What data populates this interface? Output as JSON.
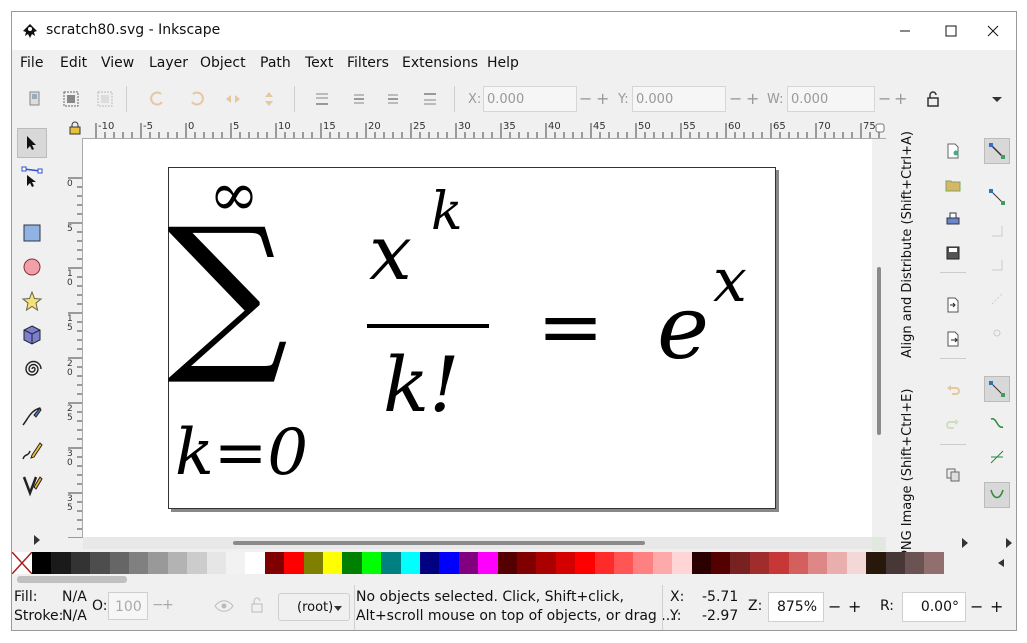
{
  "window": {
    "title": "scratch80.svg - Inkscape"
  },
  "menu": [
    "File",
    "Edit",
    "View",
    "Layer",
    "Object",
    "Path",
    "Text",
    "Filters",
    "Extensions",
    "Help"
  ],
  "toolbar": {
    "x_label": "X:",
    "x_value": "0.000",
    "y_label": "Y:",
    "y_value": "0.000",
    "w_label": "W:",
    "w_value": "0.000",
    "minus": "−",
    "plus": "+"
  },
  "ruler": {
    "top_ticks": [
      "-10",
      "-5",
      "0",
      "5",
      "10",
      "15",
      "20",
      "25",
      "30",
      "35",
      "40",
      "45",
      "50",
      "55",
      "60",
      "65",
      "70",
      "75"
    ],
    "left_ticks": [
      "0",
      "5",
      "10",
      "15",
      "20",
      "25",
      "30",
      "35",
      "40"
    ]
  },
  "canvas": {
    "formula": {
      "sum_upper": "∞",
      "sigma": "∑",
      "sum_lower": "k=0",
      "numerator_base": "x",
      "numerator_exp": "k",
      "denominator": "k!",
      "equals": "=",
      "rhs_base": "e",
      "rhs_exp": "x"
    }
  },
  "dock": {
    "tab_align": "Align and Distribute (Shift+Ctrl+A)",
    "tab_png": "PNG Image (Shift+Ctrl+E)"
  },
  "palette": {
    "colors": [
      "#000000",
      "#1a1a1a",
      "#333333",
      "#4d4d4d",
      "#666666",
      "#808080",
      "#999999",
      "#b3b3b3",
      "#cccccc",
      "#e6e6e6",
      "#f2f2f2",
      "#ffffff",
      "#800000",
      "#ff0000",
      "#808000",
      "#ffff00",
      "#008000",
      "#00ff00",
      "#008080",
      "#00ffff",
      "#000080",
      "#0000ff",
      "#800080",
      "#ff00ff",
      "#550000",
      "#800000",
      "#aa0000",
      "#d40000",
      "#ff0000",
      "#ff2a2a",
      "#ff5555",
      "#ff8080",
      "#ffaaaa",
      "#ffd5d5",
      "#2b0000",
      "#550000",
      "#782121",
      "#a02c2c",
      "#c83737",
      "#d35f5f",
      "#de8787",
      "#e9afaf",
      "#f4d7d7",
      "#28170b",
      "#483737",
      "#6c5353",
      "#916f6f"
    ]
  },
  "status": {
    "fill_label": "Fill:",
    "fill_value": "N/A",
    "stroke_label": "Stroke:",
    "stroke_value": "N/A",
    "opacity_label": "O:",
    "opacity_value": "100",
    "layer": "(root)",
    "message_line1": "No objects selected. Click, Shift+click,",
    "message_line2": "Alt+scroll mouse on top of objects, or drag ...",
    "x_label": "X:",
    "x_value": "-5.71",
    "y_label": "Y:",
    "y_value": "-2.97",
    "zoom_label": "Z:",
    "zoom_value": "875%",
    "rotate_label": "R:",
    "rotate_value": "0.00°"
  }
}
